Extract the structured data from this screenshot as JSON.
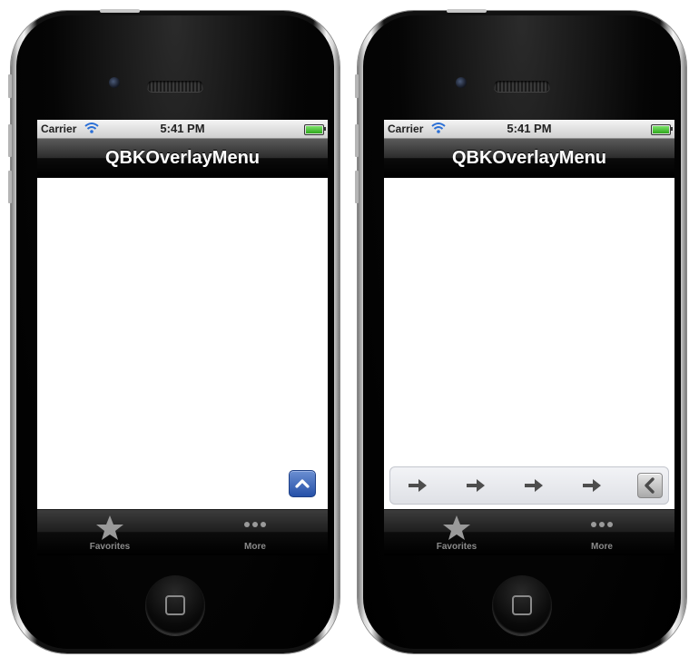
{
  "screens": [
    {
      "status_bar": {
        "carrier": "Carrier",
        "time": "5:41 PM"
      },
      "nav_bar": {
        "title": "QBKOverlayMenu"
      },
      "tab_bar": {
        "items": [
          {
            "label": "Favorites",
            "icon": "star-icon"
          },
          {
            "label": "More",
            "icon": "more-dots-icon"
          }
        ]
      },
      "overlay": {
        "state": "collapsed",
        "toggle_icon": "chevron-up-icon",
        "toggle_color": "#2f5fb8"
      }
    },
    {
      "status_bar": {
        "carrier": "Carrier",
        "time": "5:41 PM"
      },
      "nav_bar": {
        "title": "QBKOverlayMenu"
      },
      "tab_bar": {
        "items": [
          {
            "label": "Favorites",
            "icon": "star-icon"
          },
          {
            "label": "More",
            "icon": "more-dots-icon"
          }
        ]
      },
      "overlay": {
        "state": "expanded",
        "menu_items": [
          "arrow-right-icon",
          "arrow-right-icon",
          "arrow-right-icon",
          "arrow-right-icon"
        ],
        "close_icon": "chevron-left-icon"
      }
    }
  ]
}
